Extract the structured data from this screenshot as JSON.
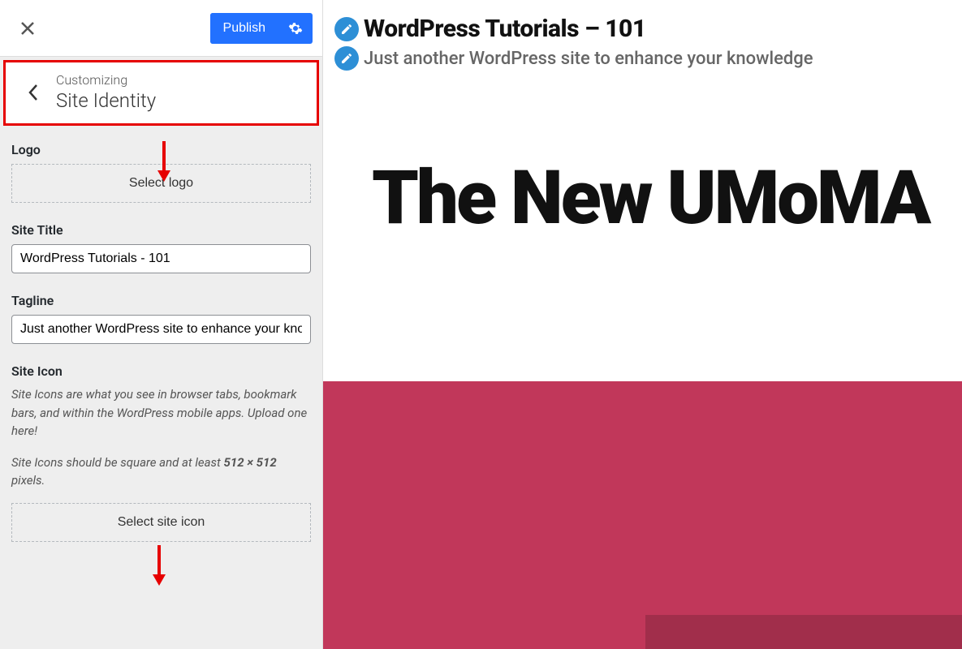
{
  "topbar": {
    "publish_label": "Publish"
  },
  "header": {
    "customizing_label": "Customizing",
    "section_title": "Site Identity"
  },
  "fields": {
    "logo_label": "Logo",
    "select_logo_label": "Select logo",
    "site_title_label": "Site Title",
    "site_title_value": "WordPress Tutorials - 101",
    "tagline_label": "Tagline",
    "tagline_value": "Just another WordPress site to enhance your knowledge",
    "site_icon_label": "Site Icon",
    "site_icon_help1": "Site Icons are what you see in browser tabs, bookmark bars, and within the WordPress mobile apps. Upload one here!",
    "site_icon_help2_pre": "Site Icons should be square and at least ",
    "site_icon_help2_size": "512 × 512",
    "site_icon_help2_post": " pixels.",
    "select_site_icon_label": "Select site icon"
  },
  "preview": {
    "site_title": "WordPress Tutorials – 101",
    "tagline": "Just another WordPress site to enhance your knowledge",
    "hero_text": "The New UMoMA"
  },
  "colors": {
    "accent_primary": "#2271ff",
    "highlight_border": "#e60000",
    "preview_band": "#c1375a",
    "preview_dark": "#a12e4b",
    "edit_badge": "#2d8fd6"
  }
}
